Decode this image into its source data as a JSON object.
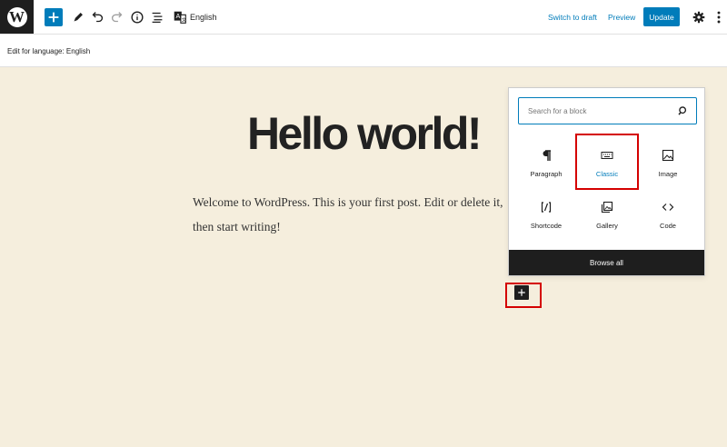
{
  "toolbar": {
    "language": "English",
    "switch_to_draft": "Switch to draft",
    "preview": "Preview",
    "update": "Update"
  },
  "subbar": {
    "text": "Edit for language: English"
  },
  "post": {
    "title": "Hello world!",
    "body": "Welcome to WordPress. This is your first post. Edit or delete it, then start writing!"
  },
  "inserter": {
    "search_placeholder": "Search for a block",
    "blocks": [
      {
        "label": "Paragraph",
        "icon": "paragraph-icon"
      },
      {
        "label": "Classic",
        "icon": "keyboard-icon"
      },
      {
        "label": "Image",
        "icon": "image-icon"
      },
      {
        "label": "Shortcode",
        "icon": "shortcode-icon"
      },
      {
        "label": "Gallery",
        "icon": "gallery-icon"
      },
      {
        "label": "Code",
        "icon": "code-icon"
      }
    ],
    "browse_all": "Browse all"
  },
  "colors": {
    "accent": "#007cba",
    "canvas": "#f5eedd",
    "highlight": "#d40000",
    "dark": "#1e1e1e"
  }
}
